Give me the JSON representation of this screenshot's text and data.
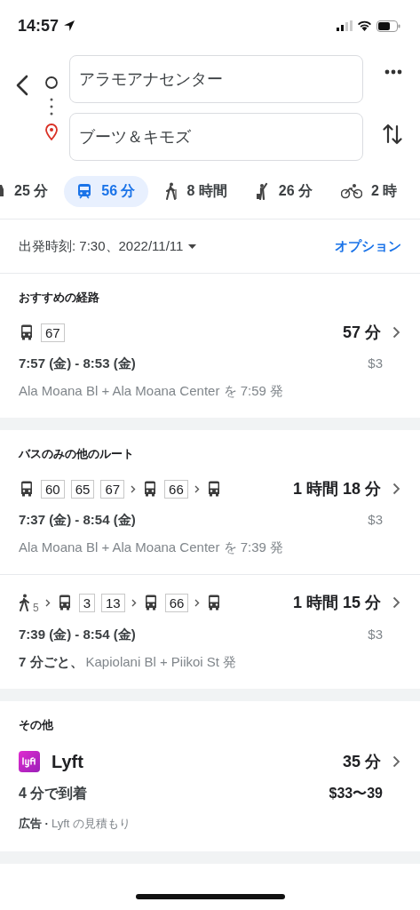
{
  "status_bar": {
    "time": "14:57"
  },
  "route": {
    "origin": "アラモアナセンター",
    "destination": "ブーツ＆キモズ"
  },
  "modes": [
    {
      "kind": "car",
      "label": "25 分",
      "selected": false
    },
    {
      "kind": "transit",
      "label": "56 分",
      "selected": true
    },
    {
      "kind": "walk",
      "label": "8 時間",
      "selected": false
    },
    {
      "kind": "ride",
      "label": "26 分",
      "selected": false
    },
    {
      "kind": "bike",
      "label": "2 時",
      "selected": false
    }
  ],
  "departure": {
    "label": "出発時刻: 7:30、2022/11/11",
    "options": "オプション"
  },
  "sections": [
    {
      "title": "おすすめの経路",
      "routes": [
        {
          "segments": [
            {
              "kind": "bus",
              "lines": [
                "67"
              ]
            }
          ],
          "duration": "57 分",
          "times": "7:57 (金) - 8:53 (金)",
          "fare": "$3",
          "note": "Ala Moana Bl + Ala Moana Center を 7:59 発"
        }
      ]
    },
    {
      "title": "バスのみの他のルート",
      "routes": [
        {
          "segments": [
            {
              "kind": "bus",
              "lines": [
                "60",
                "65",
                "67"
              ]
            },
            {
              "kind": "bus",
              "lines": [
                "66"
              ]
            },
            {
              "kind": "bus"
            }
          ],
          "duration": "1 時間 18 分",
          "times": "7:37 (金) - 8:54 (金)",
          "fare": "$3",
          "note": "Ala Moana Bl + Ala Moana Center を 7:39 発"
        },
        {
          "segments": [
            {
              "kind": "walk",
              "minutes": "5"
            },
            {
              "kind": "bus",
              "lines": [
                "3",
                "13"
              ]
            },
            {
              "kind": "bus",
              "lines": [
                "66"
              ]
            },
            {
              "kind": "bus"
            }
          ],
          "duration": "1 時間 15 分",
          "times": "7:39 (金) - 8:54 (金)",
          "fare": "$3",
          "note_lead": "7 分ごと、",
          "note": "Kapiolani Bl + Piikoi St 発"
        }
      ]
    }
  ],
  "other": {
    "title": "その他",
    "name": "Lyft",
    "duration": "35 分",
    "arrival": "4 分で到着",
    "fare": "$33〜39",
    "ad_label": "広告 ·",
    "note": "Lyft の見積もり"
  }
}
